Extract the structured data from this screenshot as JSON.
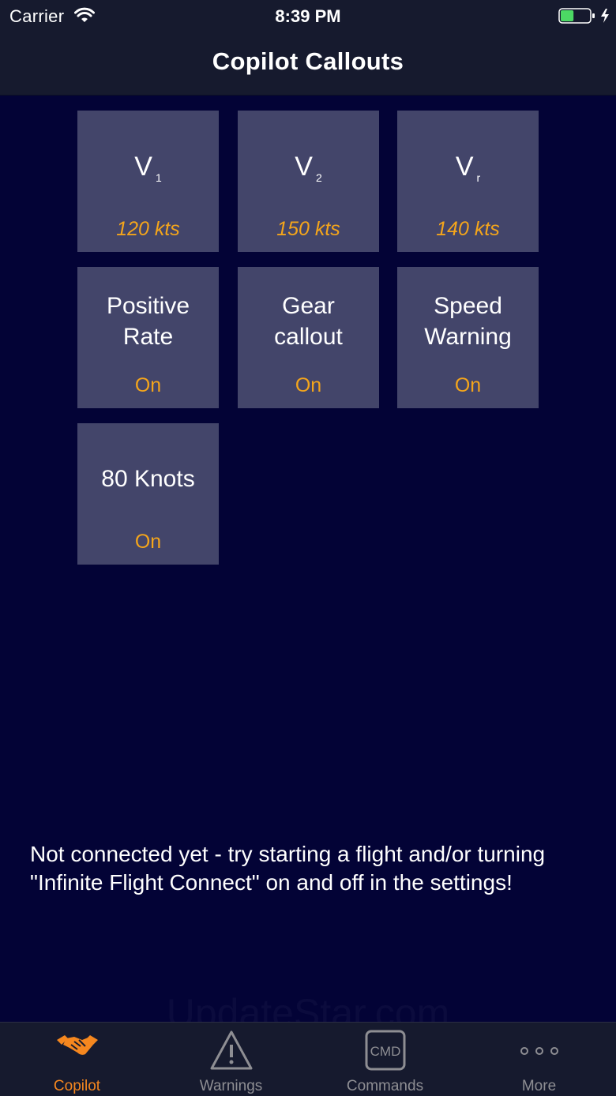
{
  "status_bar": {
    "carrier": "Carrier",
    "time": "8:39 PM",
    "wifi_icon": "wifi-icon",
    "battery_icon": "battery-charging-icon",
    "battery_level": 0.45
  },
  "nav": {
    "title": "Copilot Callouts"
  },
  "tiles": [
    {
      "title": "V",
      "subscript": "1",
      "value": "120 kts"
    },
    {
      "title": "V",
      "subscript": "2",
      "value": "150 kts"
    },
    {
      "title": "V",
      "subscript": "r",
      "value": "140 kts"
    },
    {
      "title_line1": "Positive",
      "title_line2": "Rate",
      "value": "On"
    },
    {
      "title_line1": "Gear",
      "title_line2": "callout",
      "value": "On"
    },
    {
      "title_line1": "Speed",
      "title_line2": "Warning",
      "value": "On"
    },
    {
      "title": "80 Knots",
      "value": "On"
    }
  ],
  "message": {
    "line1": "Not connected yet - try starting a flight and/or turning",
    "line2": "\"Infinite Flight Connect\" on and off in the settings!"
  },
  "watermark": "UpdateStar.com",
  "tab_bar": {
    "tabs": [
      {
        "label": "Copilot",
        "icon": "handshake-icon",
        "active": true
      },
      {
        "label": "Warnings",
        "icon": "warning-triangle-icon",
        "active": false
      },
      {
        "label": "Commands",
        "icon": "cmd-key-icon",
        "icon_text": "CMD",
        "active": false
      },
      {
        "label": "More",
        "icon": "more-dots-icon",
        "active": false
      }
    ]
  },
  "colors": {
    "background": "#030336",
    "bar": "#161a2e",
    "tile": "#43456a",
    "accent": "#f4a51b",
    "active_tab": "#f5871f",
    "inactive_tab": "#8e8e93"
  }
}
